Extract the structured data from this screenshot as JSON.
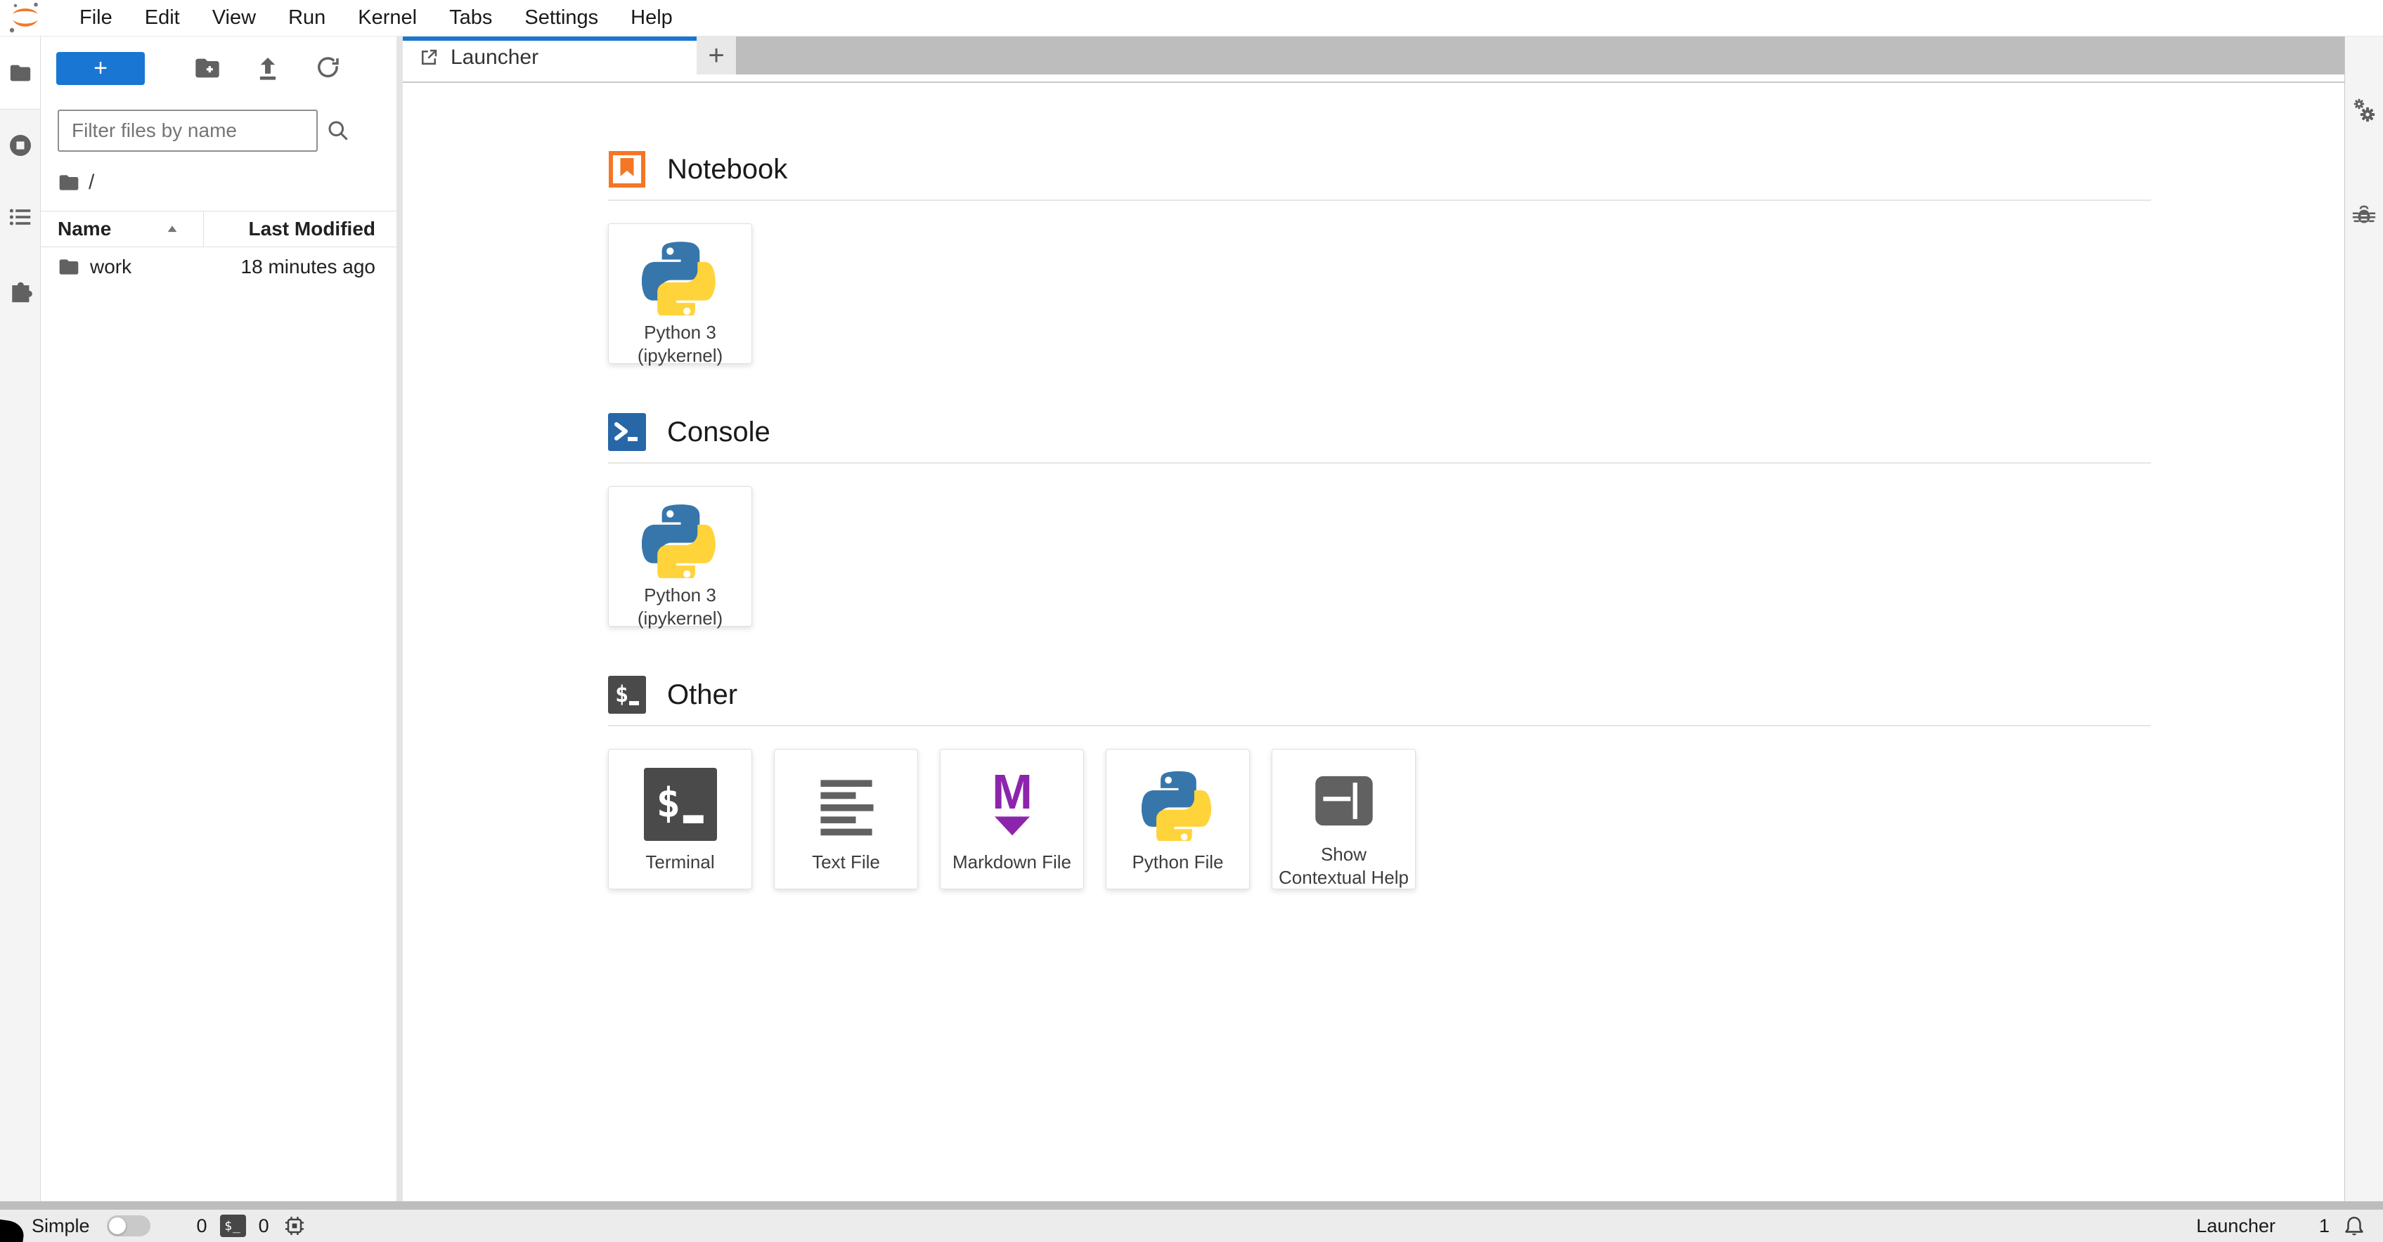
{
  "menu": {
    "items": [
      "File",
      "Edit",
      "View",
      "Run",
      "Kernel",
      "Tabs",
      "Settings",
      "Help"
    ]
  },
  "file_browser": {
    "new_launcher_label": "+",
    "filter_placeholder": "Filter files by name",
    "breadcrumb_root": "/",
    "columns": {
      "name": "Name",
      "modified": "Last Modified"
    },
    "rows": [
      {
        "name": "work",
        "modified": "18 minutes ago"
      }
    ]
  },
  "tabs": {
    "active": "Launcher",
    "add_label": "+"
  },
  "launcher": {
    "sections": [
      {
        "title": "Notebook",
        "cards": [
          {
            "label": "Python 3 (ipykernel)"
          }
        ]
      },
      {
        "title": "Console",
        "cards": [
          {
            "label": "Python 3 (ipykernel)"
          }
        ]
      },
      {
        "title": "Other",
        "cards": [
          {
            "label": "Terminal"
          },
          {
            "label": "Text File"
          },
          {
            "label": "Markdown File"
          },
          {
            "label": "Python File"
          },
          {
            "label": "Show Contextual Help"
          }
        ]
      }
    ]
  },
  "status_bar": {
    "mode_label": "Simple",
    "terminals_count": "0",
    "kernels_count": "0",
    "context_label": "Launcher",
    "notifications_count": "1"
  },
  "icons": {
    "jupyter-logo": "two orange crescents with gray dots",
    "folder-icon": "filled folder",
    "new-folder-icon": "folder with plus",
    "upload-icon": "arrow up over bar",
    "refresh-icon": "circular arrow",
    "search-icon": "magnifier",
    "sort-caret-icon": "small up triangle",
    "running-icon": "stop circle",
    "toc-icon": "bulleted list",
    "extensions-icon": "puzzle piece",
    "launcher-tab-icon": "square with NE arrow",
    "notebook-icon": "orange square with bookmark",
    "console-icon": "blue square with prompt",
    "terminal-icon": "dark square with $_",
    "text-file-icon": "stacked text lines",
    "markdown-icon": "purple M with down arrow",
    "python-logo-icon": "blue and yellow python snakes",
    "contextual-help-icon": "dark panel layout",
    "gears-icon": "two gears",
    "bug-icon": "debugger bug",
    "chip-icon": "kernel microchip",
    "bell-icon": "notification bell"
  },
  "colors": {
    "brand_blue": "#1976d2",
    "tab_band_gray": "#bdbdbd",
    "jupyter_orange": "#f37726",
    "markdown_purple": "#8d25ac",
    "python_blue": "#3776ab",
    "python_yellow": "#ffd43b",
    "statusbar_gray": "#ececec"
  }
}
